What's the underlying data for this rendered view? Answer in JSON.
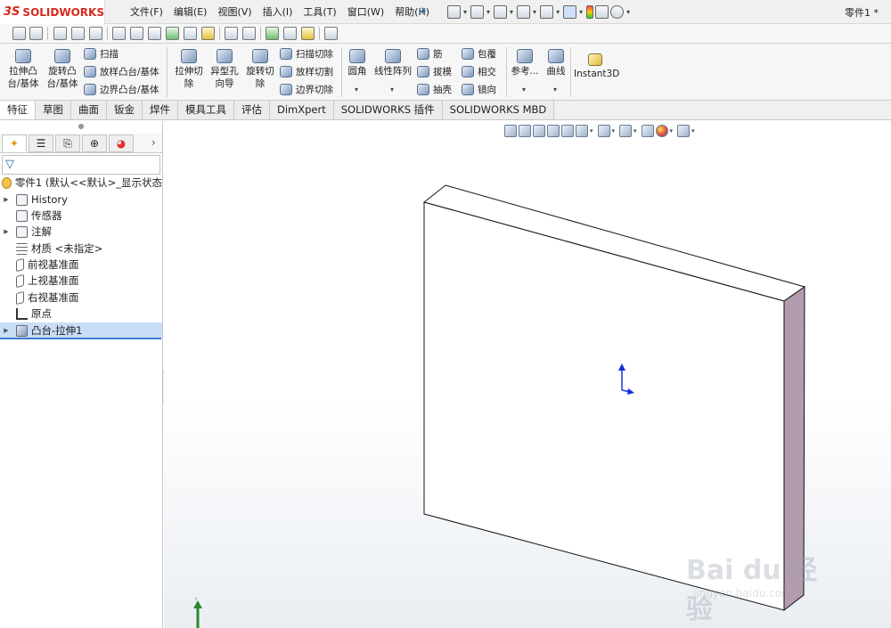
{
  "app": {
    "logo_prefix": "3S",
    "logo_text": "SOLIDWORKS",
    "document_title": "零件1 *"
  },
  "menu": [
    "文件(F)",
    "编辑(E)",
    "视图(V)",
    "插入(I)",
    "工具(T)",
    "窗口(W)",
    "帮助(H)"
  ],
  "command_manager": {
    "extrude_boss": "拉伸凸\n台/基体",
    "revolve_boss": "旋转凸\n台/基体",
    "sweep": "扫描",
    "loft_boss": "放样凸台/基体",
    "boundary_boss": "边界凸台/基体",
    "extrude_cut": "拉伸切\n除",
    "hole_wizard": "异型孔\n向导",
    "revolve_cut": "旋转切\n除",
    "swept_cut": "扫描切除",
    "lofted_cut": "放样切割",
    "boundary_cut": "边界切除",
    "fillet": "圆角",
    "linear_pattern": "线性阵列",
    "rib": "筋",
    "draft": "拔模",
    "shell": "抽壳",
    "wrap": "包覆",
    "intersect": "相交",
    "mirror": "镜向",
    "reference": "参考...",
    "curves": "曲线",
    "instant3d": "Instant3D"
  },
  "tabs": [
    "特征",
    "草图",
    "曲面",
    "钣金",
    "焊件",
    "模具工具",
    "评估",
    "DimXpert",
    "SOLIDWORKS 插件",
    "SOLIDWORKS MBD"
  ],
  "active_tab": "特征",
  "tree": {
    "root": "零件1  (默认<<默认>_显示状态",
    "items": [
      "History",
      "传感器",
      "注解",
      "材质 <未指定>",
      "前视基准面",
      "上视基准面",
      "右视基准面",
      "原点",
      "凸台-拉伸1"
    ]
  },
  "watermark": {
    "line1": "Bai du 经验",
    "line2": "jingyan.baidu.com"
  },
  "colors": {
    "brand": "#d62a1e",
    "selection": "#c9ddf7",
    "part_side": "#b39cb0",
    "axis": "#1230d8"
  }
}
